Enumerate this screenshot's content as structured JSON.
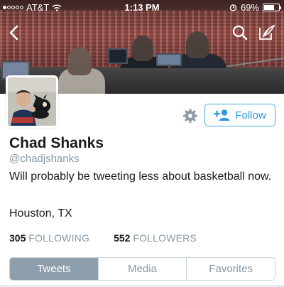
{
  "status_bar": {
    "carrier": "AT&T",
    "time": "1:13 PM",
    "battery": "69%",
    "battery_level": 0.69,
    "signal_bars_filled": 1,
    "signal_bars_total": 5
  },
  "nav": {
    "back_icon": "chevron-left-icon",
    "search_icon": "search-icon",
    "compose_icon": "compose-icon"
  },
  "profile": {
    "name": "Chad Shanks",
    "handle": "@chadjshanks",
    "bio": "Will probably be tweeting less about basketball now.",
    "location": "Houston, TX"
  },
  "actions": {
    "settings_icon": "gear-icon",
    "follow_label": "Follow",
    "follow_icon": "add-user-icon"
  },
  "stats": {
    "following_count": "305",
    "following_label": "FOLLOWING",
    "followers_count": "552",
    "followers_label": "FOLLOWERS"
  },
  "tabs": [
    {
      "label": "Tweets",
      "active": true
    },
    {
      "label": "Media",
      "active": false
    },
    {
      "label": "Favorites",
      "active": false
    }
  ],
  "colors": {
    "accent": "#2e9ae0",
    "active_tab": "#8d9fac",
    "secondary_text": "#8899a6"
  }
}
